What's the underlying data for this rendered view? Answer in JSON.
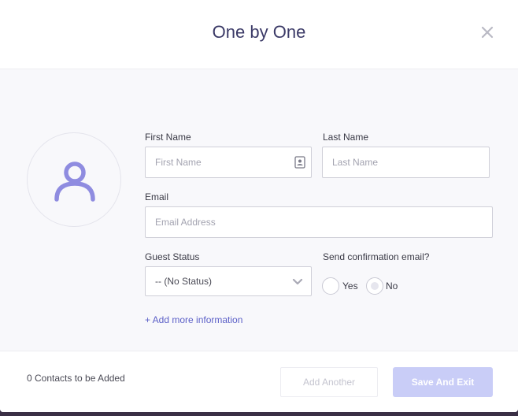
{
  "modal": {
    "title": "One by One"
  },
  "form": {
    "first_name": {
      "label": "First Name",
      "placeholder": "First Name",
      "value": ""
    },
    "last_name": {
      "label": "Last Name",
      "placeholder": "Last Name",
      "value": ""
    },
    "email": {
      "label": "Email",
      "placeholder": "Email Address",
      "value": ""
    },
    "guest_status": {
      "label": "Guest Status",
      "selected": "-- (No Status)"
    },
    "send_confirmation": {
      "label": "Send confirmation email?",
      "options": [
        {
          "label": "Yes",
          "selected": false
        },
        {
          "label": "No",
          "selected": true
        }
      ]
    },
    "add_more_link": "+ Add more information"
  },
  "footer": {
    "contacts_count": "0 Contacts to be Added",
    "add_another_label": "Add Another",
    "save_exit_label": "Save And Exit"
  },
  "colors": {
    "accent": "#5b5fc7",
    "avatar": "#8f8ce0",
    "title": "#3b3a67",
    "save_button_disabled": "#c9cdf7"
  },
  "icons": {
    "close": "close-icon",
    "avatar": "user-icon",
    "contact_card": "contact-card-icon",
    "chevron": "chevron-down-icon"
  }
}
